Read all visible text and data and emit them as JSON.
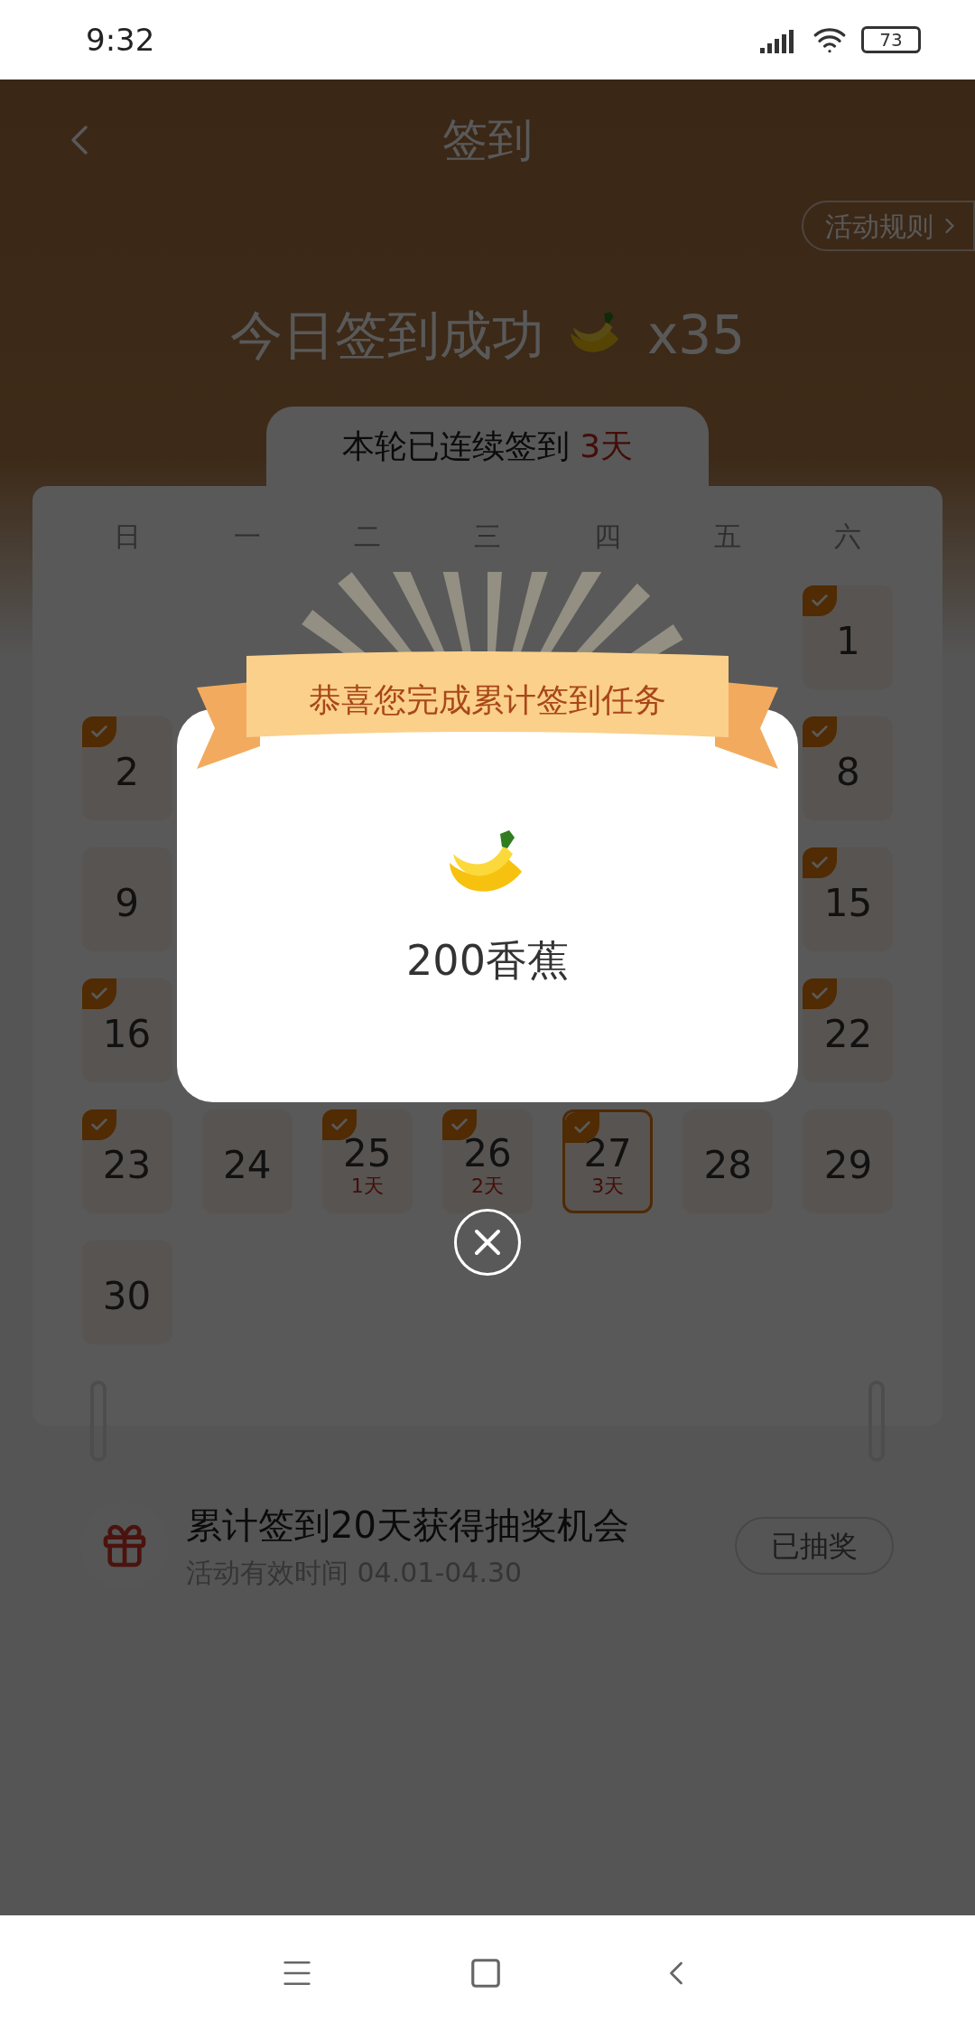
{
  "status_bar": {
    "time": "9:32",
    "battery": "73"
  },
  "header": {
    "title": "签到",
    "rules_button": "活动规则"
  },
  "today": {
    "text": "今日签到成功",
    "reward": "x35"
  },
  "streak": {
    "text": "本轮已连续签到 ",
    "days": "3天"
  },
  "weekdays": [
    "日",
    "一",
    "二",
    "三",
    "四",
    "五",
    "六"
  ],
  "weeks": [
    [
      {
        "kind": "blank"
      },
      {
        "kind": "blank"
      },
      {
        "kind": "blank"
      },
      {
        "kind": "blank"
      },
      {
        "kind": "blank"
      },
      {
        "kind": "blank"
      },
      {
        "kind": "day",
        "day": "1",
        "checked": true,
        "today": false
      }
    ],
    [
      {
        "kind": "day",
        "day": "2",
        "checked": true,
        "today": false
      },
      {
        "kind": "blank"
      },
      {
        "kind": "blank"
      },
      {
        "kind": "blank"
      },
      {
        "kind": "blank"
      },
      {
        "kind": "blank"
      },
      {
        "kind": "day",
        "day": "8",
        "checked": true,
        "today": false
      }
    ],
    [
      {
        "kind": "day",
        "day": "9",
        "checked": false,
        "today": false
      },
      {
        "kind": "blank"
      },
      {
        "kind": "blank"
      },
      {
        "kind": "blank"
      },
      {
        "kind": "blank"
      },
      {
        "kind": "blank"
      },
      {
        "kind": "day",
        "day": "15",
        "checked": true,
        "today": false
      }
    ],
    [
      {
        "kind": "day",
        "day": "16",
        "checked": true,
        "today": false
      },
      {
        "kind": "blank"
      },
      {
        "kind": "blank"
      },
      {
        "kind": "blank"
      },
      {
        "kind": "blank"
      },
      {
        "kind": "blank"
      },
      {
        "kind": "day",
        "day": "22",
        "checked": true,
        "today": false
      }
    ],
    [
      {
        "kind": "day",
        "day": "23",
        "checked": true,
        "today": false
      },
      {
        "kind": "day",
        "day": "24",
        "checked": false,
        "today": false
      },
      {
        "kind": "day",
        "day": "25",
        "checked": true,
        "today": false,
        "streak": "1天"
      },
      {
        "kind": "day",
        "day": "26",
        "checked": true,
        "today": false,
        "streak": "2天"
      },
      {
        "kind": "day",
        "day": "27",
        "checked": true,
        "today": true,
        "streak": "3天"
      },
      {
        "kind": "day",
        "day": "28",
        "checked": false,
        "today": false
      },
      {
        "kind": "day",
        "day": "29",
        "checked": false,
        "today": false
      }
    ],
    [
      {
        "kind": "day",
        "day": "30",
        "checked": false,
        "today": false
      }
    ]
  ],
  "prize": {
    "title": "累计签到20天获得抽奖机会",
    "subtitle": "活动有效时间 04.01-04.30",
    "button": "已抽奖"
  },
  "dialog": {
    "title": "恭喜您完成累计签到任务",
    "reward": "200香蕉"
  }
}
